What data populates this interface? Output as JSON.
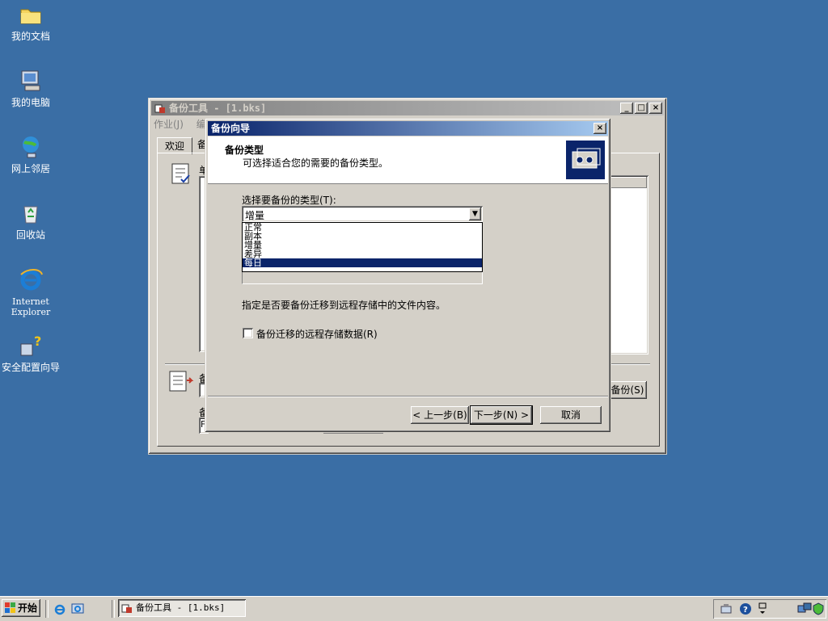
{
  "desktop": {
    "icons": [
      {
        "label": "我的文档"
      },
      {
        "label": "我的电脑"
      },
      {
        "label": "网上邻居"
      },
      {
        "label": "回收站"
      },
      {
        "label": "Internet\nExplorer"
      },
      {
        "label": "安全配置向导"
      }
    ]
  },
  "backup_window": {
    "title": "备份工具 - [1.bks]",
    "menu": [
      "作业(J)",
      "编"
    ],
    "tabs": [
      "欢迎",
      "备"
    ],
    "section_label": "单",
    "bottom_labels": [
      "备",
      "备"
    ],
    "bottom_field": "F",
    "start_backup_button": "备份(S)"
  },
  "wizard": {
    "title": "备份向导",
    "header_title": "备份类型",
    "header_subtitle": "可选择适合您的需要的备份类型。",
    "type_label": "选择要备份的类型(T):",
    "selected_value": "增量",
    "options": [
      "正常",
      "副本",
      "增量",
      "差异",
      "每日"
    ],
    "highlighted_option": "每日",
    "remote_text": "指定是否要备份迁移到远程存储中的文件内容。",
    "checkbox_label": "备份迁移的远程存储数据(R)",
    "checkbox_checked": false,
    "back_button": "< 上一步(B)",
    "next_button": "下一步(N) >",
    "cancel_button": "取消"
  },
  "taskbar": {
    "start_label": "开始",
    "task_label": "备份工具 - [1.bks]"
  },
  "colors": {
    "desktop": "#3a6ea5",
    "title_active": "#0a246a",
    "selection": "#0a246a",
    "face": "#d4d0c8"
  }
}
